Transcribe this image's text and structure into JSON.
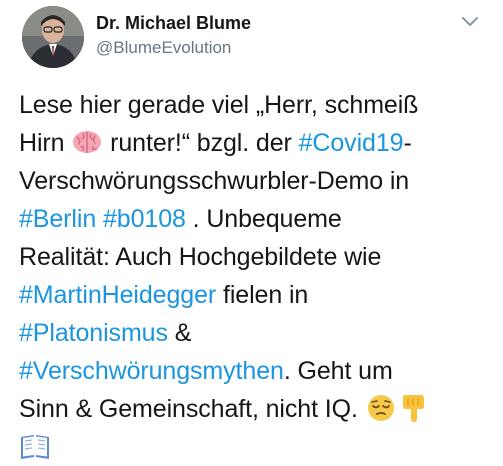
{
  "author": {
    "display_name": "Dr. Michael Blume",
    "handle": "@BlumeEvolution"
  },
  "icons": {
    "menu": "chevron-down-icon",
    "brain": "brain-emoji",
    "pensive": "pensive-face-emoji",
    "pointing_down": "backhand-index-pointing-down-emoji",
    "book": "open-book-emoji"
  },
  "colors": {
    "text": "#14171a",
    "secondary": "#657786",
    "hashtag": "#1b95e0"
  },
  "tweet": {
    "l1": "Lese hier gerade viel „Herr, schmeiß",
    "l2a": "Hirn ",
    "l2b": " runter!“ bzgl. der ",
    "l2tag": "#Covid19",
    "l2c": "-",
    "l3": "Verschwörungsschwurbler-Demo in",
    "l4tag1": "#Berlin",
    "l4sp": " ",
    "l4tag2": "#b0108",
    "l4b": " . Unbequeme",
    "l5": "Realität: Auch Hochgebildete wie",
    "l6tag": "#MartinHeidegger",
    "l6b": " fielen in",
    "l7tag": "#Platonismus",
    "l7b": " &",
    "l8tag": "#Verschwörungsmythen",
    "l8b": ". Geht um",
    "l9": "Sinn & Gemeinschaft, nicht IQ. "
  }
}
